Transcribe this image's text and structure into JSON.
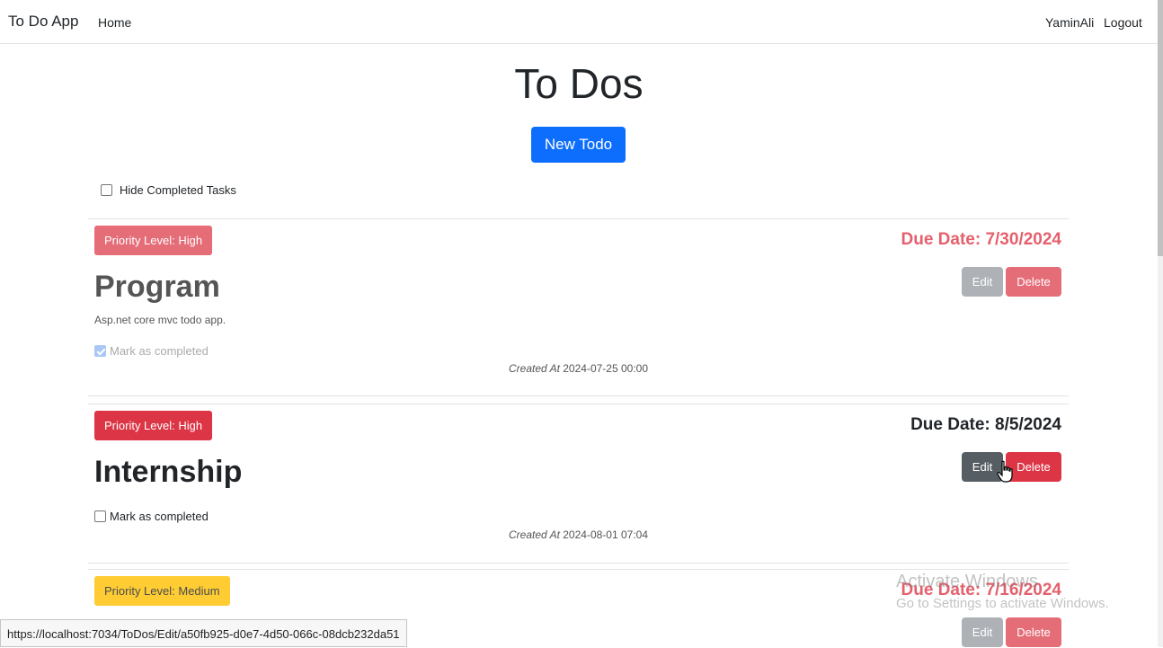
{
  "nav": {
    "brand": "To Do App",
    "home": "Home",
    "user": "YaminAli",
    "logout": "Logout"
  },
  "page": {
    "title": "To Dos",
    "new_button": "New Todo",
    "hide_completed_label": "Hide Completed Tasks",
    "hide_completed_checked": false
  },
  "todos": [
    {
      "priority": "Priority Level: High",
      "due": "Due Date: 7/30/2024",
      "title": "Program",
      "description": "Asp.net core mvc todo app.",
      "mark_label": "Mark as completed",
      "completed": true,
      "created_label": "Created At",
      "created_value": "2024-07-25 00:00",
      "edit": "Edit",
      "delete": "Delete"
    },
    {
      "priority": "Priority Level: High",
      "due": "Due Date: 8/5/2024",
      "title": "Internship",
      "description": "",
      "mark_label": "Mark as completed",
      "completed": false,
      "created_label": "Created At",
      "created_value": "2024-08-01 07:04",
      "edit": "Edit",
      "delete": "Delete"
    },
    {
      "priority": "Priority Level: Medium",
      "due": "Due Date: 7/16/2024",
      "edit": "Edit",
      "delete": "Delete"
    }
  ],
  "status_bar": {
    "url": "https://localhost:7034/ToDos/Edit/a50fb925-d0e7-4d50-066c-08dcb232da51"
  },
  "watermark": {
    "line1": "Activate Windows",
    "line2": "Go to Settings to activate Windows."
  },
  "colors": {
    "primary": "#0d6efd",
    "danger": "#dc3545",
    "warning": "#ffc107",
    "secondary": "#565e64"
  }
}
